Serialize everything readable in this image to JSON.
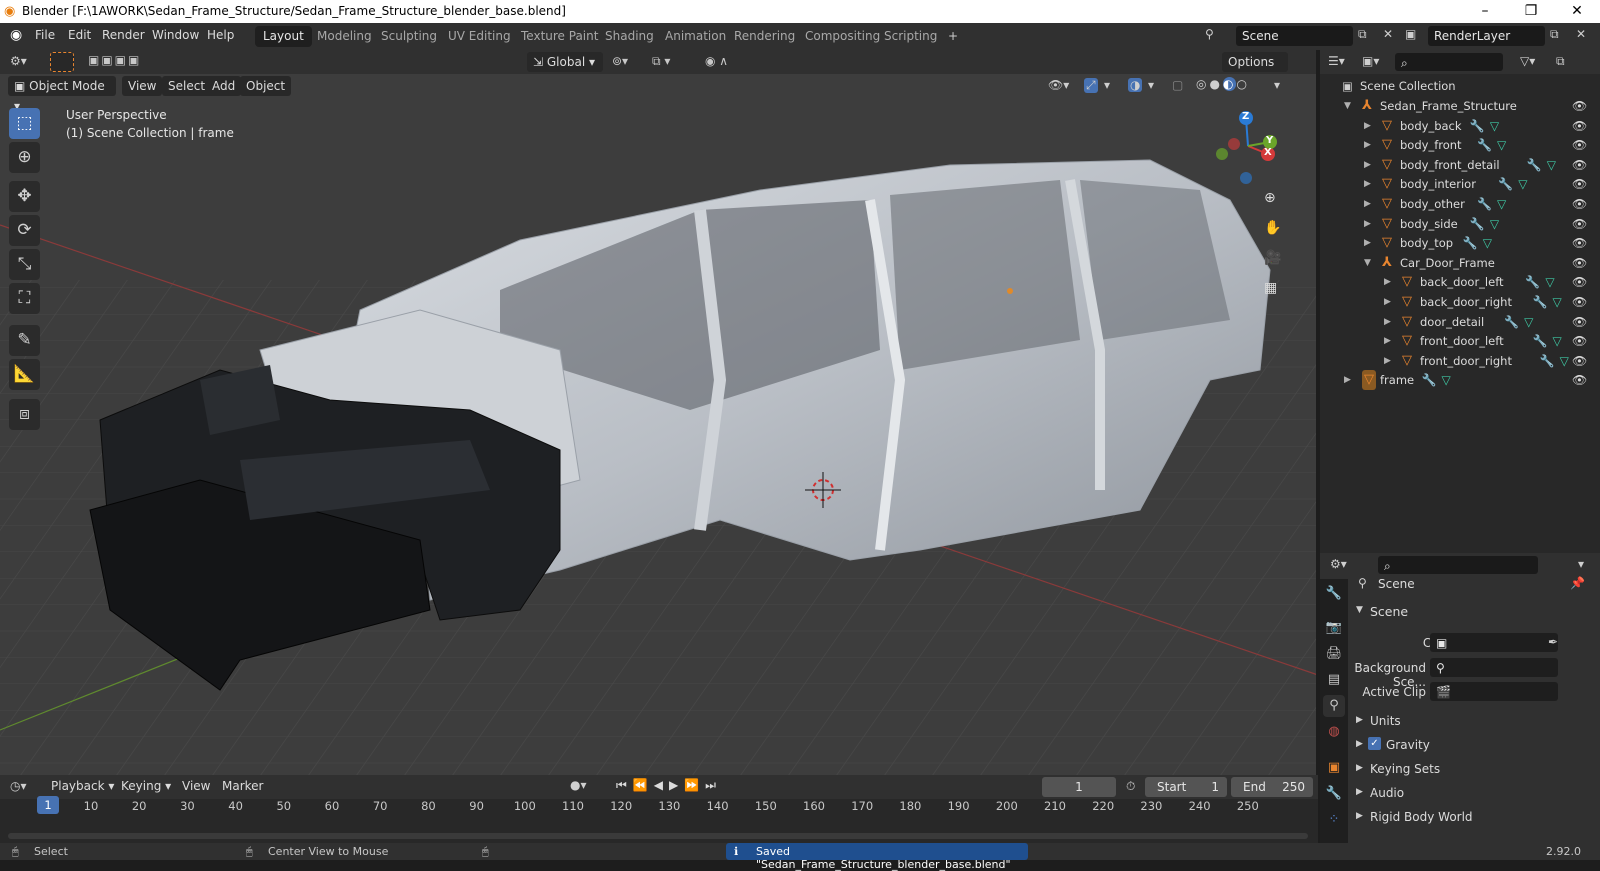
{
  "title_bar": {
    "title": "Blender [F:\\1AWORK\\Sedan_Frame_Structure/Sedan_Frame_Structure_blender_base.blend]"
  },
  "menu": [
    "File",
    "Edit",
    "Render",
    "Window",
    "Help"
  ],
  "workspaces": [
    "Layout",
    "Modeling",
    "Sculpting",
    "UV Editing",
    "Texture Paint",
    "Shading",
    "Animation",
    "Rendering",
    "Compositing",
    "Scripting"
  ],
  "active_workspace": "Layout",
  "scene_field": "Scene",
  "render_layer_field": "RenderLayer",
  "viewport": {
    "mode": "Object Mode",
    "header_menus": [
      "View",
      "Select",
      "Add",
      "Object"
    ],
    "transform_orientation": "Global",
    "options_label": "Options",
    "overlay_line1": "User Perspective",
    "overlay_line2": "(1) Scene Collection | frame",
    "gizmo": {
      "z": "Z",
      "x": "X",
      "y": "Y"
    }
  },
  "outliner": {
    "root": "Scene Collection",
    "items": [
      {
        "label": "Sedan_Frame_Structure",
        "type": "empty",
        "depth": 0,
        "expanded": true
      },
      {
        "label": "body_back",
        "type": "mesh",
        "depth": 1
      },
      {
        "label": "body_front",
        "type": "mesh",
        "depth": 1
      },
      {
        "label": "body_front_detail",
        "type": "mesh",
        "depth": 1
      },
      {
        "label": "body_interior",
        "type": "mesh",
        "depth": 1
      },
      {
        "label": "body_other",
        "type": "mesh",
        "depth": 1
      },
      {
        "label": "body_side",
        "type": "mesh",
        "depth": 1
      },
      {
        "label": "body_top",
        "type": "mesh",
        "depth": 1
      },
      {
        "label": "Car_Door_Frame",
        "type": "empty",
        "depth": 1,
        "expanded": true
      },
      {
        "label": "back_door_left",
        "type": "mesh",
        "depth": 2
      },
      {
        "label": "back_door_right",
        "type": "mesh",
        "depth": 2
      },
      {
        "label": "door_detail",
        "type": "mesh",
        "depth": 2
      },
      {
        "label": "front_door_left",
        "type": "mesh",
        "depth": 2
      },
      {
        "label": "front_door_right",
        "type": "mesh",
        "depth": 2
      },
      {
        "label": "frame",
        "type": "mesh",
        "depth": 0,
        "active": true
      }
    ]
  },
  "properties": {
    "context": "Scene",
    "panel": "Scene",
    "camera_label": "Camera",
    "background_label": "Background Sce...",
    "active_clip_label": "Active Clip",
    "subpanels": [
      "Units",
      "Gravity",
      "Keying Sets",
      "Audio",
      "Rigid Body World"
    ],
    "gravity_checked": true
  },
  "timeline": {
    "menus": [
      "Playback",
      "Keying",
      "View",
      "Marker"
    ],
    "current_frame": "1",
    "start_label": "Start",
    "start_value": "1",
    "end_label": "End",
    "end_value": "250",
    "ticks": [
      "1",
      "10",
      "20",
      "30",
      "40",
      "50",
      "60",
      "70",
      "80",
      "90",
      "100",
      "110",
      "120",
      "130",
      "140",
      "150",
      "160",
      "170",
      "180",
      "190",
      "200",
      "210",
      "220",
      "230",
      "240",
      "250"
    ]
  },
  "status_bar": {
    "left_hint": "Select",
    "middle_hint": "Center View to Mouse",
    "message": "Saved \"Sedan_Frame_Structure_blender_base.blend\"",
    "version": "2.92.0"
  },
  "colors": {
    "accent": "#4772b3",
    "object_orange": "#e8852f",
    "mesh_green": "#3fc8a4"
  }
}
